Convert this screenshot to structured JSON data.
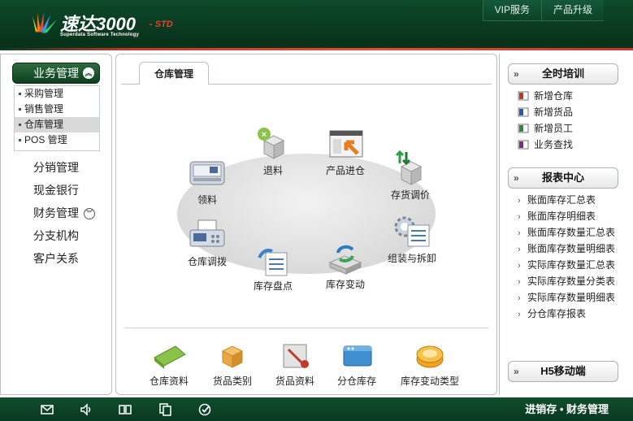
{
  "header": {
    "brand": "速达3000",
    "edition": "- STD",
    "tagline": "Superdata Software Technology",
    "nav": [
      "VIP服务",
      "产品升级"
    ]
  },
  "sidebar": {
    "active_group": "业务管理",
    "sub_items": [
      "采购管理",
      "销售管理",
      "仓库管理",
      "POS 管理"
    ],
    "selected_sub": "仓库管理",
    "groups": [
      "分销管理",
      "现金银行",
      "财务管理",
      "分支机构",
      "客户关系"
    ]
  },
  "main": {
    "tab": "仓库管理",
    "flow": {
      "ret": "退料",
      "in": "产品进仓",
      "pick": "领料",
      "adjust": "存货调价",
      "transfer": "仓库调拨",
      "assemble": "组装与拆卸",
      "count": "库存盘点",
      "change": "库存变动"
    },
    "bottom": [
      "仓库资料",
      "货品类别",
      "货品资料",
      "分仓库存",
      "库存变动类型"
    ]
  },
  "right": {
    "training": {
      "title": "全时培训",
      "items": [
        "新增仓库",
        "新增货品",
        "新增员工",
        "业务查找"
      ]
    },
    "reports": {
      "title": "报表中心",
      "items": [
        "账面库存汇总表",
        "账面库存明细表",
        "账面库存数量汇总表",
        "账面库存数量明细表",
        "实际库存数量汇总表",
        "实际库存数量分类表",
        "实际库存数量明细表",
        "分仓库存报表"
      ]
    },
    "mobile": {
      "title": "H5移动端"
    }
  },
  "footer": {
    "icons": [
      "mail-icon",
      "speaker-icon",
      "book-icon",
      "copy-icon",
      "check-icon"
    ],
    "text": "进销存 • 财务管理"
  },
  "colors": {
    "header_green": "#0a3a20",
    "accent_red": "#e74c3c",
    "sub_marker": "#1e6b35"
  }
}
